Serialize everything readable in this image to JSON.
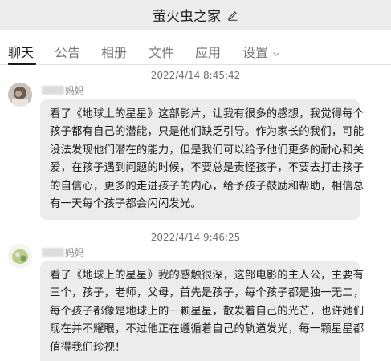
{
  "window": {
    "title": "萤火虫之家"
  },
  "tabs": [
    {
      "label": "聊天",
      "active": true
    },
    {
      "label": "公告"
    },
    {
      "label": "相册"
    },
    {
      "label": "文件"
    },
    {
      "label": "应用"
    },
    {
      "label": "设置"
    }
  ],
  "messages": [
    {
      "timestamp": "2022/4/14 8:45:42",
      "sender_suffix": "妈妈",
      "lines": [
        "看了《地球上的星星》这部影片，让我有很多的感想，我觉得每个",
        "孩子都有自己的潜能，只是他们缺乏引导。作为家长的我们，可能",
        "没法发现他们潜在的能力，但是我们可以给予他们更多的耐心和关",
        "爱，在孩子遇到问题的时候，不要总是责怪孩子，不要去打击孩子",
        "的自信心，更多的走进孩子的内心，给予孩子鼓励和帮助，相信总",
        "有一天每个孩子都会闪闪发光。"
      ]
    },
    {
      "timestamp": "2022/4/14 9:46:25",
      "sender_suffix": "妈妈",
      "lines": [
        "看了《地球上的星星》我的感触很深，这部电影的主人公，主要有",
        "三个，孩子，老师，父母，首先是孩子，每个孩子都是独一无二，",
        "每个孩子都像是地球上的一颗星星，散发着自己的光芒，也许她们",
        "现在并不耀眼，不过他正在遵循着自己的轨道发光，每一颗星星都",
        "值得我们珍视！"
      ]
    }
  ]
}
